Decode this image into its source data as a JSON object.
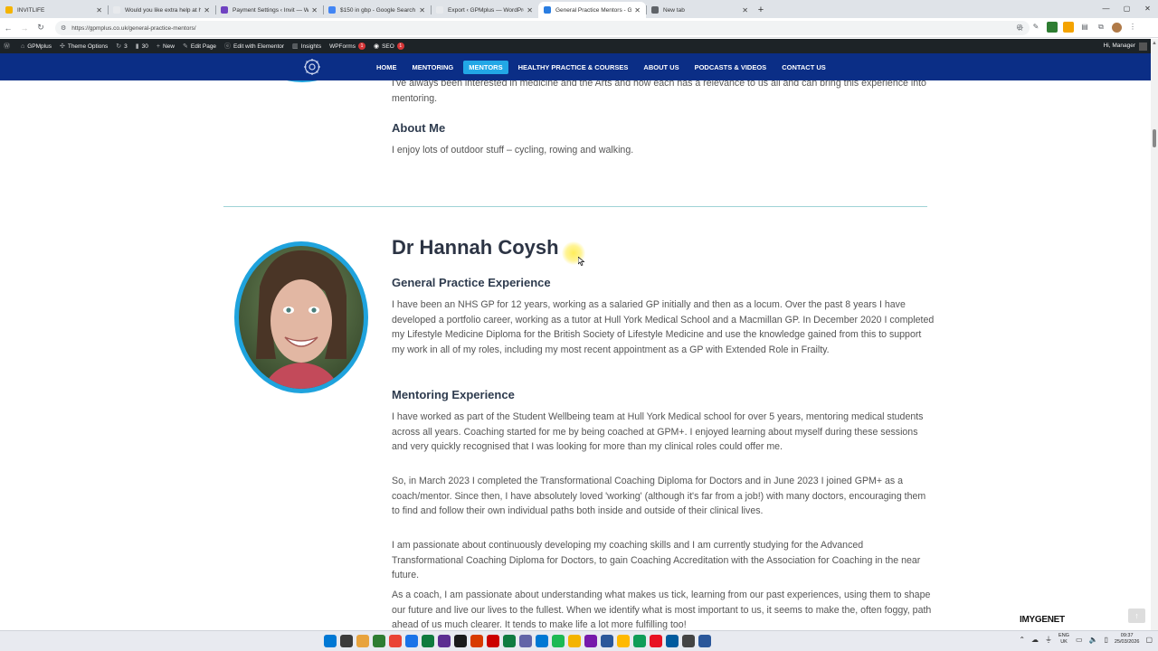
{
  "browser": {
    "tabs": [
      {
        "title": "INVITLIFE",
        "color": "#f4b400",
        "active": false
      },
      {
        "title": "Would you like extra help at h",
        "color": "#e8eaed",
        "active": false
      },
      {
        "title": "Payment Settings ‹ Invit — Wo",
        "color": "#6f42c1",
        "active": false
      },
      {
        "title": "$150 in gbp - Google Search",
        "color": "#4285f4",
        "active": false
      },
      {
        "title": "Export ‹ GPMplus — WordPress",
        "color": "#e8eaed",
        "active": false
      },
      {
        "title": "General Practice Mentors - GP",
        "color": "#2a7de1",
        "active": true
      },
      {
        "title": "New tab",
        "color": "#5f6368",
        "active": false
      }
    ],
    "url": "https://gpmplus.co.uk/general-practice-mentors/"
  },
  "wpbar": {
    "site": "GPMplus",
    "theme_options": "Theme Options",
    "updates": "3",
    "comments": "30",
    "new": "New",
    "edit_page": "Edit Page",
    "edit_elementor": "Edit with Elementor",
    "insights": "Insights",
    "wpforms": "WPForms",
    "wpforms_badge": "1",
    "seo": "SEO",
    "seo_badge": "1",
    "howdy": "Hi, Manager"
  },
  "nav": {
    "items": [
      "HOME",
      "MENTORING",
      "MENTORS",
      "HEALTHY PRACTICE & COURSES",
      "ABOUT US",
      "PODCASTS & VIDEOS",
      "CONTACT US"
    ],
    "active_index": 2,
    "bg": "#0b2e86",
    "accent": "#22a7e6"
  },
  "prev_mentor": {
    "intro": "I've always been interested in medicine and the Arts and how each has a relevance to us all and can bring this experience into mentoring.",
    "about_heading": "About Me",
    "about_text": "I enjoy lots of outdoor stuff – cycling, rowing and walking."
  },
  "mentor": {
    "name": "Dr Hannah Coysh",
    "gp_heading": "General Practice Experience",
    "gp_text": "I have been an NHS GP for 12 years, working as a salaried GP initially and then as a locum. Over the past 8 years I have developed a portfolio career, working as a tutor at Hull York Medical School and a Macmillan GP. In December 2020 I completed my Lifestyle Medicine Diploma for the British Society of Lifestyle Medicine and use the knowledge gained from this to support my work in all of my roles, including my most recent appointment as a GP with Extended Role in Frailty.",
    "mentoring_heading": "Mentoring Experience",
    "mentoring_paragraphs": [
      "I have worked as part of the Student Wellbeing team at Hull York Medical school for over 5 years, mentoring medical students across all years. Coaching started for me by being coached at GPM+. I enjoyed learning about myself during these sessions and very quickly recognised that I was looking for more than my clinical roles could offer me.",
      "So, in March 2023 I completed the Transformational Coaching Diploma for Doctors and in June 2023 I joined GPM+ as a coach/mentor. Since then, I have absolutely loved 'working' (although it's far from a job!) with many doctors, encouraging them to find and follow their own individual paths both inside and outside of their clinical lives.",
      "I am passionate about continuously developing my coaching skills and I am currently studying for the Advanced Transformational Coaching Diploma for Doctors, to gain Coaching Accreditation with the Association for Coaching in the near future.",
      "As a coach, I am passionate about understanding what makes us tick, learning from our past experiences, using them to shape our future and live our lives to the fullest. When we identify what is most important to us, it seems to make the, often foggy, path ahead of us much clearer. It tends to make life a lot more fulfilling too!"
    ]
  },
  "watermark": "IMYGENET",
  "tray": {
    "lang_top": "ENG",
    "lang_bottom": "UK",
    "time": "09:37",
    "date": "25/03/2026"
  }
}
